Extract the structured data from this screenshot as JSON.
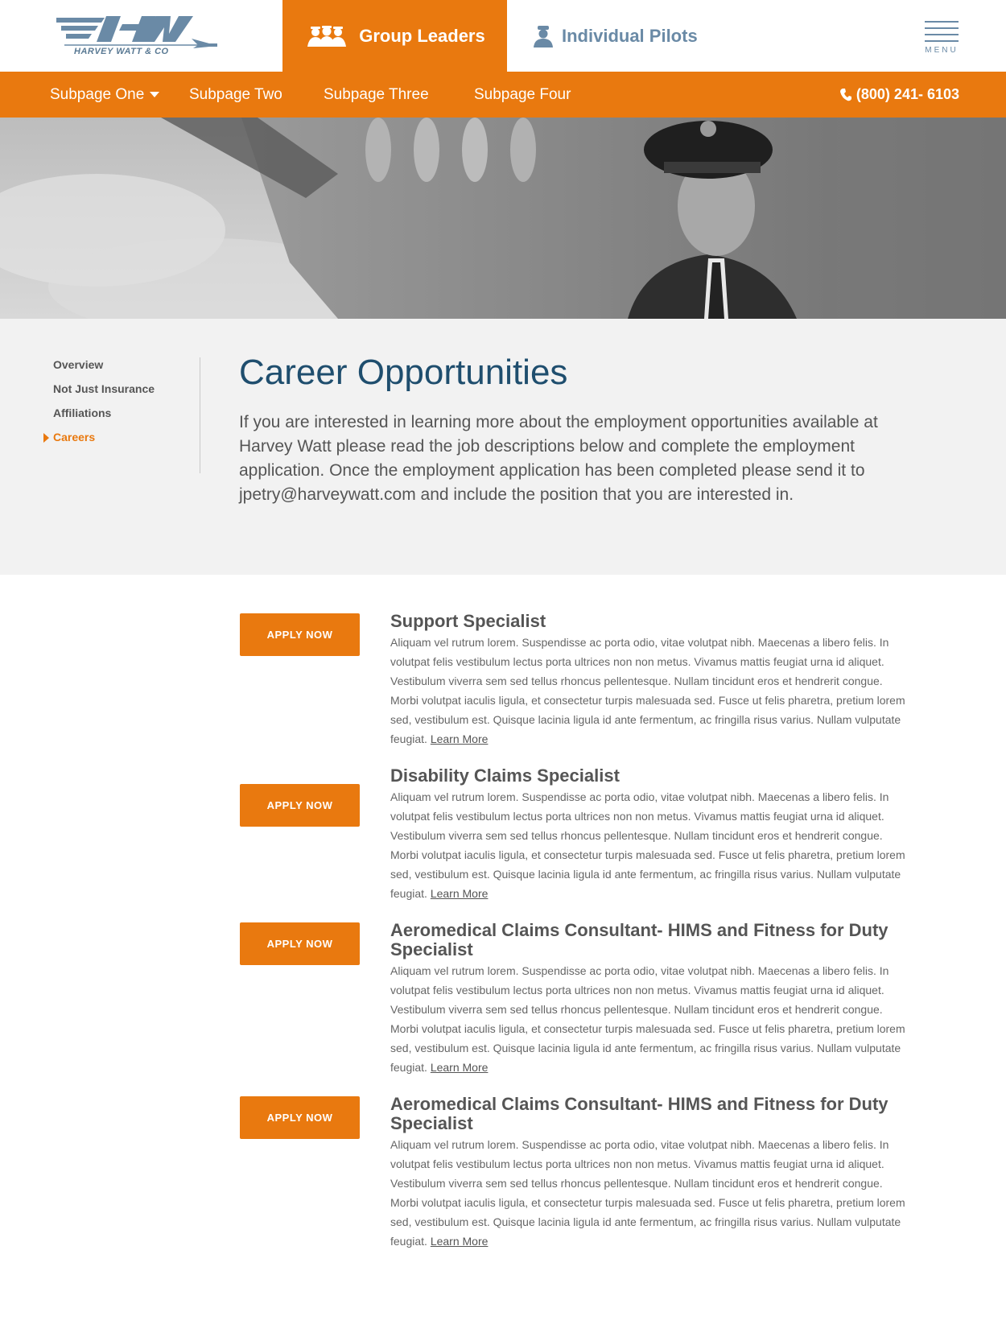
{
  "header": {
    "logo_text": "HARVEY WATT & CO",
    "tab_group_leaders": "Group Leaders",
    "tab_individual_pilots": "Individual Pilots",
    "menu_label": "MENU"
  },
  "nav": {
    "items": [
      "Subpage One",
      "Subpage Two",
      "Subpage Three",
      "Subpage Four"
    ],
    "phone": "(800) 241- 6103"
  },
  "sidebar": {
    "items": [
      "Overview",
      "Not Just Insurance",
      "Affiliations",
      "Careers"
    ],
    "active": "Careers"
  },
  "intro": {
    "title": "Career Opportunities",
    "text": "If you are interested in learning more about the employment opportunities available at Harvey Watt please read the job descriptions below and complete the employment application. Once the employment application has been completed please send it to jpetry@harveywatt.com and include the position that you are interested in."
  },
  "jobs": [
    {
      "apply_label": "APPLY NOW",
      "title": "Support Specialist",
      "description": "Aliquam vel rutrum lorem. Suspendisse ac porta odio, vitae volutpat nibh. Maecenas a libero felis. In volutpat felis vestibulum lectus porta ultrices non non metus. Vivamus mattis feugiat urna id aliquet. Vestibulum viverra sem sed tellus rhoncus pellentesque. Nullam tincidunt eros et hendrerit congue. Morbi volutpat iaculis ligula, et consectetur turpis malesuada sed. Fusce ut felis pharetra, pretium lorem sed, vestibulum est. Quisque lacinia ligula id ante fermentum, ac fringilla risus varius. Nullam vulputate feugiat.",
      "learn_more": "Learn More"
    },
    {
      "apply_label": "APPLY NOW",
      "title": "Disability Claims Specialist",
      "description": "Aliquam vel rutrum lorem. Suspendisse ac porta odio, vitae volutpat nibh. Maecenas a libero felis. In volutpat felis vestibulum lectus porta ultrices non non metus. Vivamus mattis feugiat urna id aliquet. Vestibulum viverra sem sed tellus rhoncus pellentesque. Nullam tincidunt eros et hendrerit congue. Morbi volutpat iaculis ligula, et consectetur turpis malesuada sed. Fusce ut felis pharetra, pretium lorem sed, vestibulum est. Quisque lacinia ligula id ante fermentum, ac fringilla risus varius. Nullam vulputate feugiat.",
      "learn_more": "Learn More"
    },
    {
      "apply_label": "APPLY NOW",
      "title": "Aeromedical Claims Consultant- HIMS and Fitness for Duty Specialist",
      "description": "Aliquam vel rutrum lorem. Suspendisse ac porta odio, vitae volutpat nibh. Maecenas a libero felis. In volutpat felis vestibulum lectus porta ultrices non non metus. Vivamus mattis feugiat urna id aliquet. Vestibulum viverra sem sed tellus rhoncus pellentesque. Nullam tincidunt eros et hendrerit congue. Morbi volutpat iaculis ligula, et consectetur turpis malesuada sed. Fusce ut felis pharetra, pretium lorem sed, vestibulum est. Quisque lacinia ligula id ante fermentum, ac fringilla risus varius. Nullam vulputate feugiat.",
      "learn_more": "Learn More"
    },
    {
      "apply_label": "APPLY NOW",
      "title": "Aeromedical Claims Consultant- HIMS and Fitness for Duty Specialist",
      "description": "Aliquam vel rutrum lorem. Suspendisse ac porta odio, vitae volutpat nibh. Maecenas a libero felis. In volutpat felis vestibulum lectus porta ultrices non non metus. Vivamus mattis feugiat urna id aliquet. Vestibulum viverra sem sed tellus rhoncus pellentesque. Nullam tincidunt eros et hendrerit congue. Morbi volutpat iaculis ligula, et consectetur turpis malesuada sed. Fusce ut felis pharetra, pretium lorem sed, vestibulum est. Quisque lacinia ligula id ante fermentum, ac fringilla risus varius. Nullam vulputate feugiat.",
      "learn_more": "Learn More"
    }
  ],
  "colors": {
    "accent": "#e9790f",
    "title_blue": "#1f4e6e",
    "logo_blue": "#6a8aa6"
  },
  "icons": [
    "group-leaders-icon",
    "pilot-icon",
    "hamburger-menu-icon",
    "phone-icon",
    "chevron-down-icon",
    "caret-right-icon"
  ]
}
